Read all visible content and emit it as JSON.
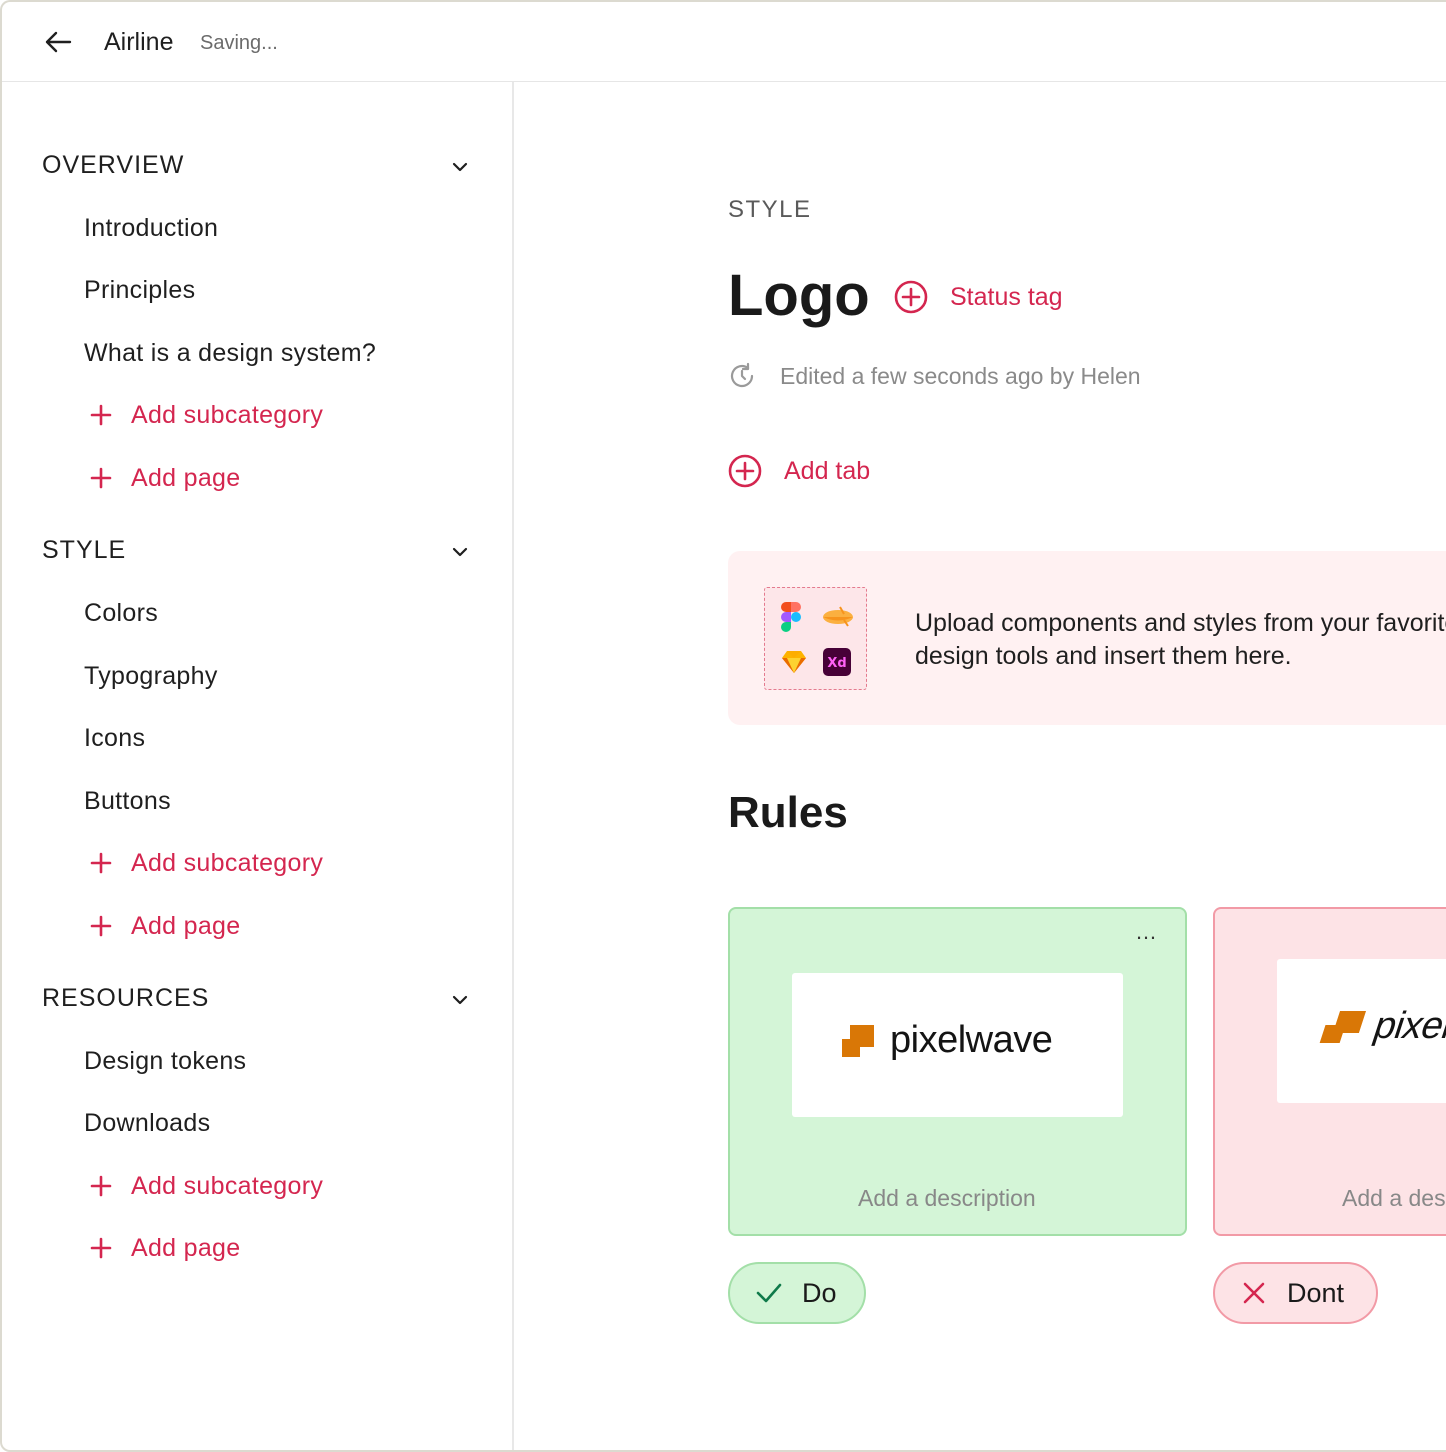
{
  "header": {
    "title": "Airline",
    "status": "Saving..."
  },
  "sidebar": {
    "sections": [
      {
        "label": "OVERVIEW",
        "items": [
          "Introduction",
          "Principles",
          "What is a design system?"
        ],
        "add_subcategory": "Add subcategory",
        "add_page": "Add page"
      },
      {
        "label": "STYLE",
        "items": [
          "Colors",
          "Typography",
          "Icons",
          "Buttons"
        ],
        "add_subcategory": "Add subcategory",
        "add_page": "Add page"
      },
      {
        "label": "RESOURCES",
        "items": [
          "Design tokens",
          "Downloads"
        ],
        "add_subcategory": "Add subcategory",
        "add_page": "Add page"
      }
    ]
  },
  "main": {
    "kicker": "STYLE",
    "title": "Logo",
    "status_tag": "Status tag",
    "edited": "Edited a few seconds ago by Helen",
    "add_tab": "Add tab",
    "upload": {
      "line1": "Upload components and styles from your favorite",
      "line2": "design tools and insert them here.",
      "tool_icons": [
        "figma-icon",
        "abstract-icon",
        "sketch-icon",
        "adobe-xd-icon"
      ]
    },
    "rules_title": "Rules",
    "rules": [
      {
        "kind": "do",
        "logo_text": "pixelwave",
        "description_placeholder": "Add a description",
        "pill_label": "Do"
      },
      {
        "kind": "dont",
        "logo_text": "pixelwave",
        "description_placeholder": "Add a description",
        "pill_label": "Dont"
      }
    ]
  },
  "colors": {
    "accent": "#d4264f",
    "do_bg": "#d4f5d7",
    "do_border": "#a3dfa8",
    "dont_bg": "#fde3e6",
    "dont_border": "#f29aa6",
    "logo_orange": "#d97706"
  }
}
